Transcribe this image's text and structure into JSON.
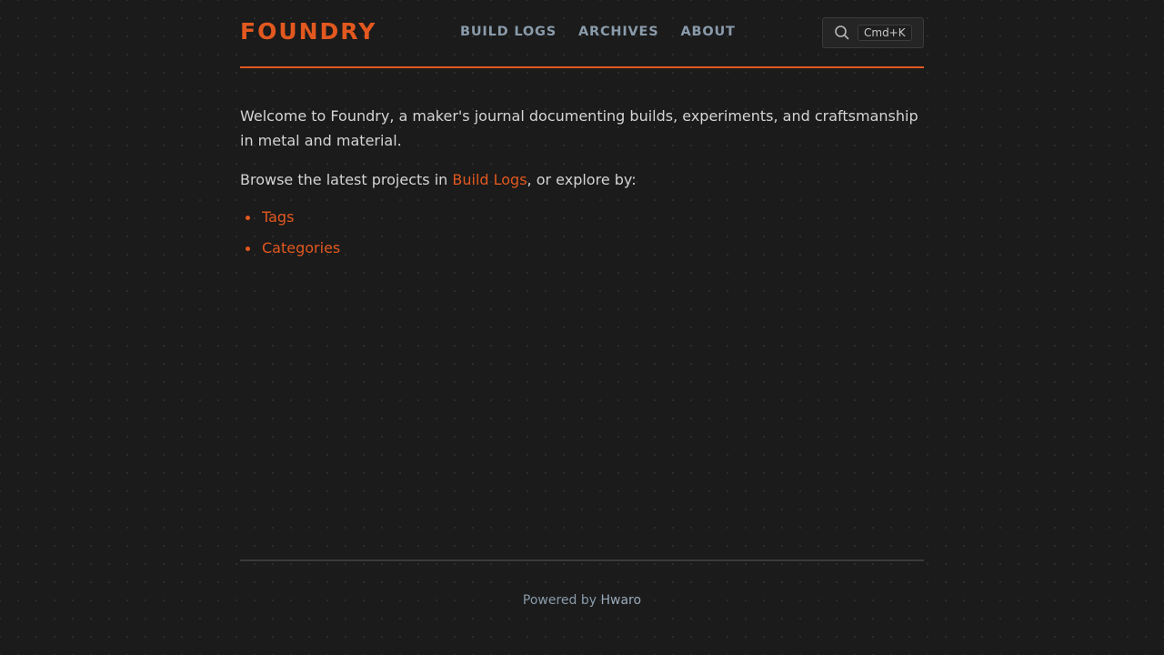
{
  "site": {
    "logo": "FOUNDRY"
  },
  "nav": {
    "items": [
      {
        "label": "BUILD LOGS"
      },
      {
        "label": "ARCHIVES"
      },
      {
        "label": "ABOUT"
      }
    ]
  },
  "search": {
    "icon": "search-icon",
    "shortcut": "Cmd+K"
  },
  "content": {
    "intro": "Welcome to Foundry, a maker's journal documenting builds, experiments, and craftsmanship in metal and material.",
    "browse_prefix": "Browse the latest projects in ",
    "browse_link": "Build Logs",
    "browse_suffix": ", or explore by:",
    "links": [
      {
        "label": "Tags"
      },
      {
        "label": "Categories"
      }
    ]
  },
  "footer": {
    "powered_prefix": "Powered by ",
    "powered_link": "Hwaro"
  },
  "colors": {
    "accent": "#e2581f",
    "background": "#1b1b1b",
    "nav_text": "#8a9bab",
    "body_text": "#d4d4d4"
  }
}
